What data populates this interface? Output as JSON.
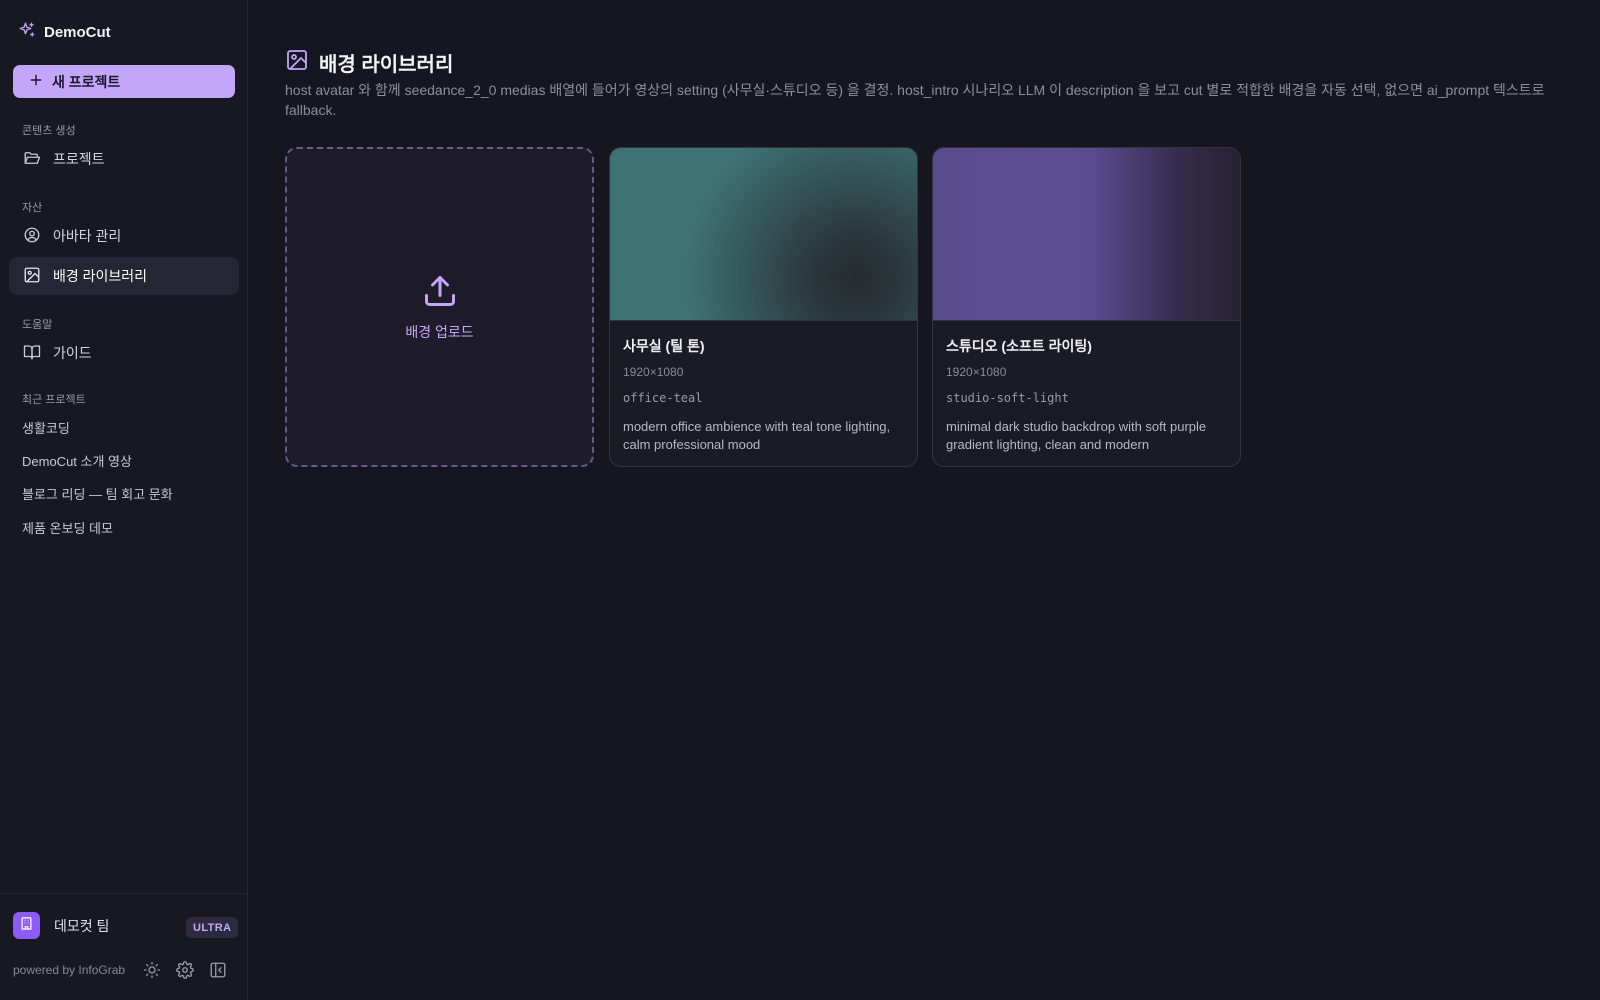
{
  "app": {
    "name": "DemoCut"
  },
  "sidebar": {
    "new_project_label": "새 프로젝트",
    "sections": {
      "content": "콘텐츠 생성",
      "assets": "자산",
      "help": "도움말",
      "recent": "최근 프로젝트"
    },
    "items": {
      "projects": "프로젝트",
      "avatars": "아바타 관리",
      "backgrounds": "배경 라이브러리",
      "guide": "가이드"
    },
    "recent_projects": [
      "생활코딩",
      "DemoCut 소개 영상",
      "블로그 리딩 — 팀 회고 문화",
      "제품 온보딩 데모"
    ],
    "team": {
      "name": "데모컷 팀",
      "plan": "ULTRA"
    },
    "powered_by": "powered by InfoGrab"
  },
  "main": {
    "title": "배경 라이브러리",
    "description": "host avatar 와 함께 seedance_2_0 medias 배열에 들어가 영상의 setting (사무실·스튜디오 등) 을 결정. host_intro 시나리오 LLM 이 description 을 보고 cut 별로 적합한 배경을 자동 선택, 없으면 ai_prompt 텍스트로 fallback.",
    "upload_label": "배경 업로드",
    "backgrounds": [
      {
        "title": "사무실 (틸 톤)",
        "size": "1920×1080",
        "slug": "office-teal",
        "description": "modern office ambience with teal tone lighting, calm professional mood"
      },
      {
        "title": "스튜디오 (소프트 라이팅)",
        "size": "1920×1080",
        "slug": "studio-soft-light",
        "description": "minimal dark studio backdrop with soft purple gradient lighting, clean and modern"
      }
    ]
  },
  "colors": {
    "accent": "#c3a6f7",
    "background": "#161620",
    "sidebar": "#181822",
    "active_item": "#252634"
  }
}
